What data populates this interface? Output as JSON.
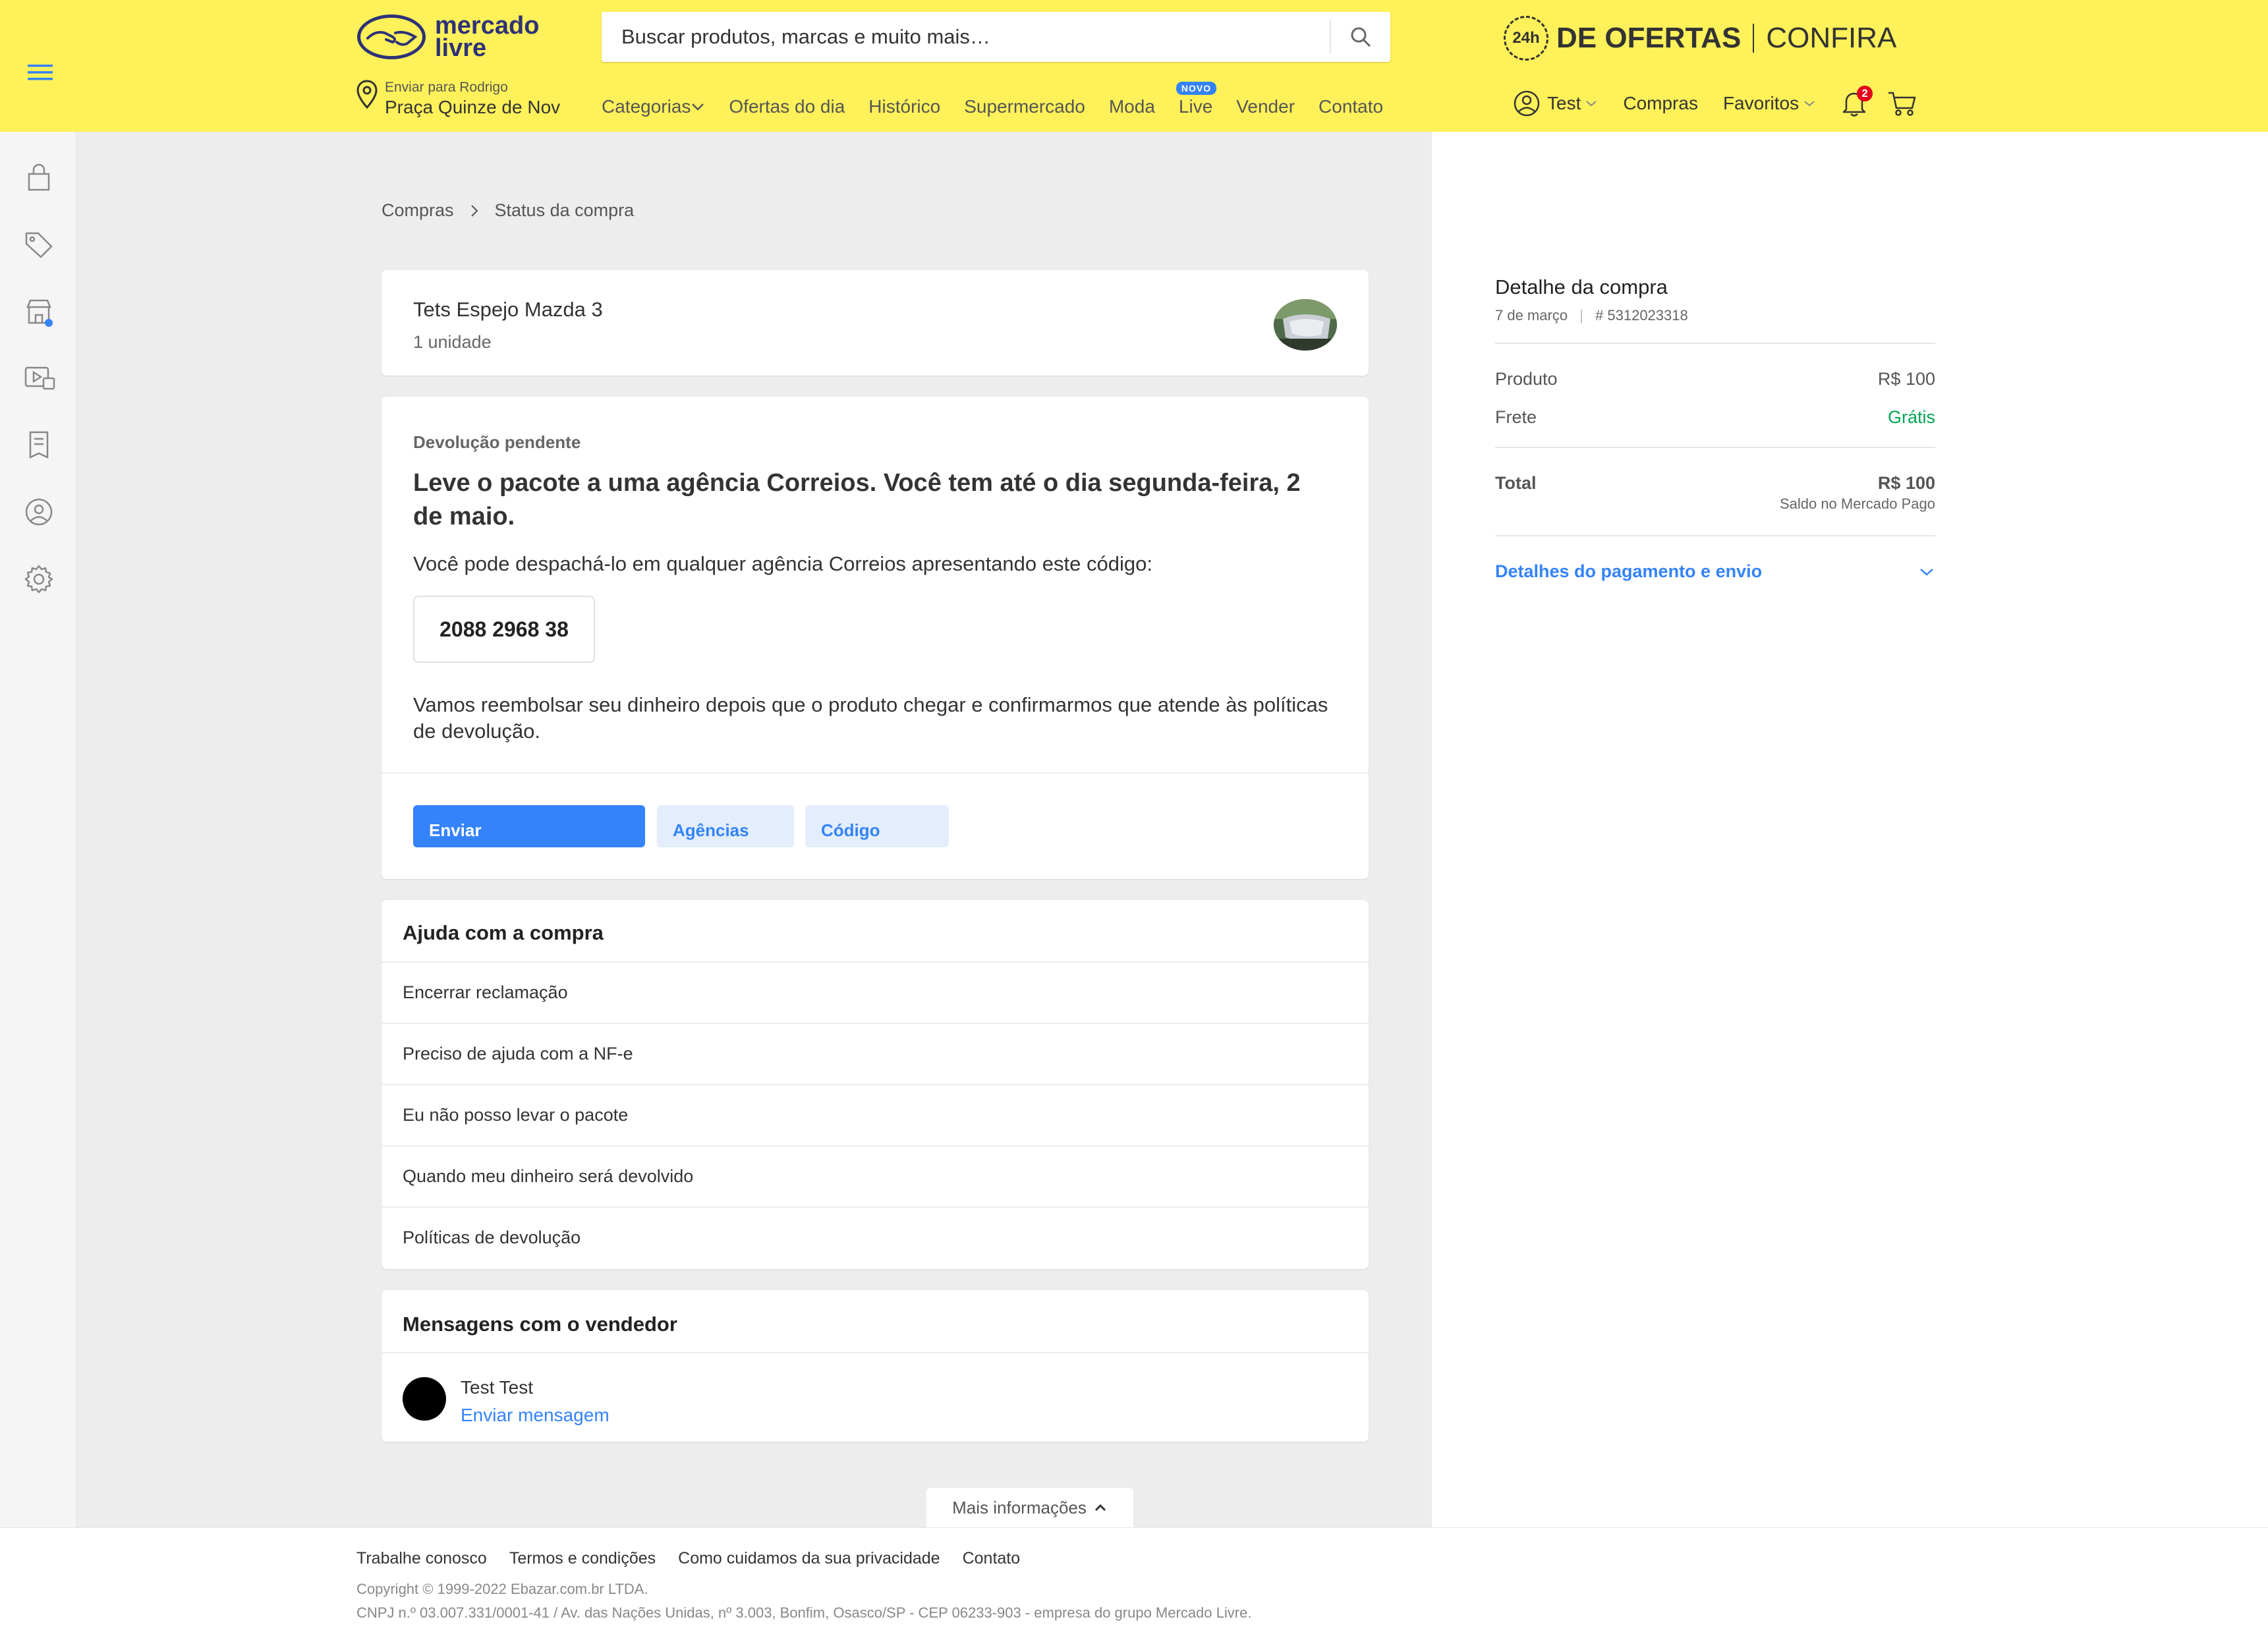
{
  "header": {
    "logo_text": [
      "mercado",
      "livre"
    ],
    "search_placeholder": "Buscar produtos, marcas e muito mais…",
    "promo": {
      "badge": "24h",
      "bold": "DE OFERTAS",
      "light": "CONFIRA"
    },
    "location": {
      "label": "Enviar para Rodrigo",
      "address": "Praça Quinze de Nov"
    },
    "nav": [
      "Categorias",
      "Ofertas do dia",
      "Histórico",
      "Supermercado",
      "Moda",
      "Live",
      "Vender",
      "Contato"
    ],
    "nav_badge": "NOVO",
    "user": "Test",
    "purchases": "Compras",
    "favorites": "Favoritos",
    "notifications_count": "2"
  },
  "breadcrumb": {
    "root": "Compras",
    "current": "Status da compra"
  },
  "product": {
    "title": "Tets Espejo Mazda 3",
    "units": "1 unidade"
  },
  "return": {
    "status": "Devolução pendente",
    "title": "Leve o pacote a uma agência Correios. Você tem até o dia segunda-feira, 2 de maio.",
    "subtitle": "Você pode despachá-lo em qualquer agência Correios apresentando este código:",
    "code": "2088 2968 38",
    "note": "Vamos reembolsar seu dinheiro depois que o produto chegar e confirmarmos que atende às políticas de devolução.",
    "buttons": [
      "Enviar",
      "Agências",
      "Código"
    ]
  },
  "help": {
    "title": "Ajuda com a compra",
    "items": [
      "Encerrar reclamação",
      "Preciso de ajuda com a NF-e",
      "Eu não posso levar o pacote",
      "Quando meu dinheiro será devolvido",
      "Políticas de devolução"
    ]
  },
  "messages": {
    "title": "Mensagens com o vendedor",
    "seller": "Test Test",
    "action": "Enviar mensagem"
  },
  "more_info": "Mais informações",
  "purchase_detail": {
    "title": "Detalhe da compra",
    "date": "7 de março",
    "order_id": "# 5312023318",
    "product_label": "Produto",
    "product_value": "R$ 100",
    "shipping_label": "Frete",
    "shipping_value": "Grátis",
    "total_label": "Total",
    "total_value": "R$ 100",
    "total_note": "Saldo no Mercado Pago",
    "details_link": "Detalhes do pagamento e envio"
  },
  "footer": {
    "links": [
      "Trabalhe conosco",
      "Termos e condições",
      "Como cuidamos da sua privacidade",
      "Contato"
    ],
    "copyright": "Copyright © 1999-2022 Ebazar.com.br LTDA.",
    "cnpj": "CNPJ n.º 03.007.331/0001-41 / Av. das Nações Unidas, nº 3.003, Bonfim, Osasco/SP - CEP 06233-903 - empresa do grupo Mercado Livre."
  },
  "colors": {
    "header": "#fff159",
    "accent": "#3483fa",
    "success": "#00a650",
    "badge": "#e2001a"
  },
  "icons": [
    "menu-icon",
    "search-icon",
    "location-pin-icon",
    "user-icon",
    "chevron-down-icon",
    "bell-icon",
    "cart-icon",
    "bag-icon",
    "tag-icon",
    "store-icon",
    "video-icon",
    "receipt-icon",
    "profile-icon",
    "gear-icon",
    "chevron-right-icon",
    "chevron-up-icon"
  ]
}
